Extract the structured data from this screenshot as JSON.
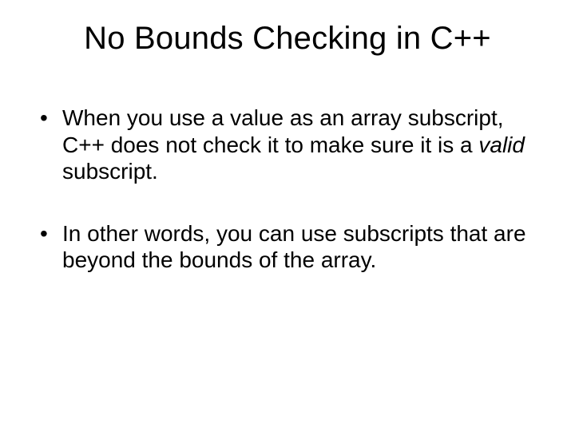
{
  "title": "No Bounds Checking in C++",
  "bullets": [
    {
      "pre": "When you use a value as an array subscript, C++ does not check it to make sure it is a ",
      "italic": "valid",
      "post": " subscript."
    },
    {
      "pre": "In other words, you can use subscripts that are beyond the bounds of the array.",
      "italic": "",
      "post": ""
    }
  ]
}
